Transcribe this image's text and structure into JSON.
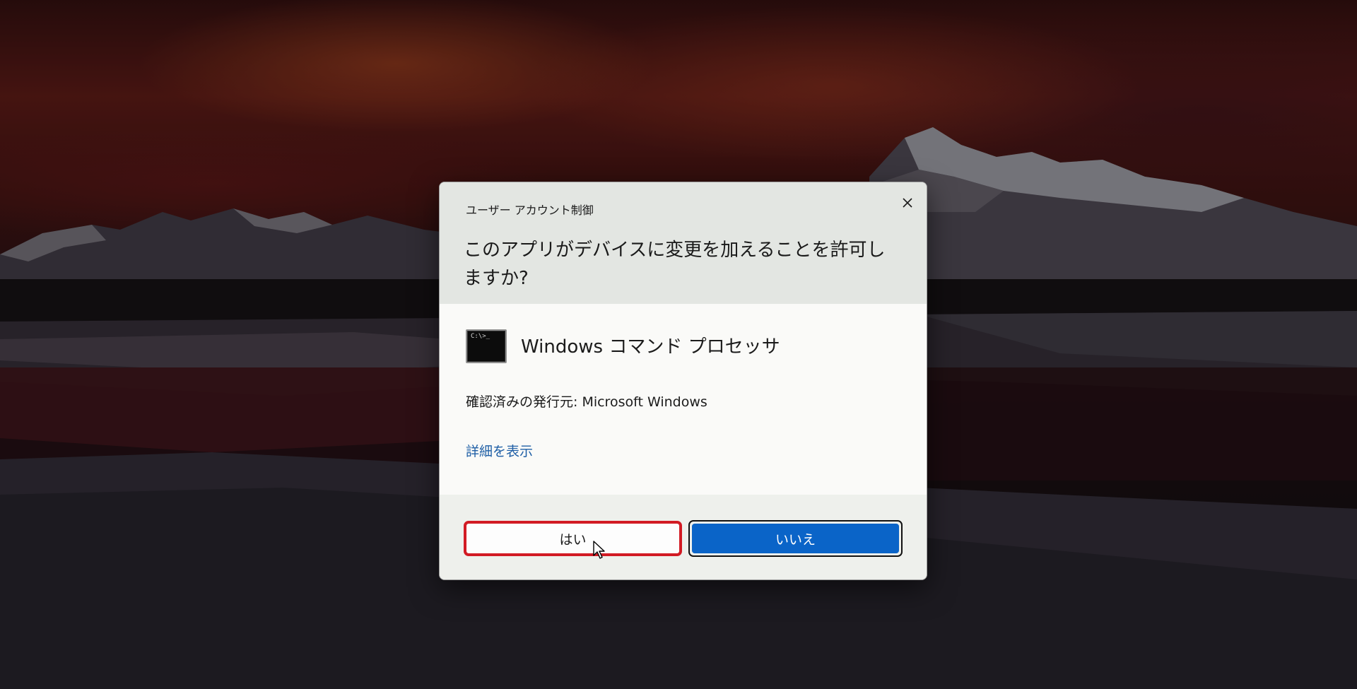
{
  "dialog": {
    "caption": "ユーザー アカウント制御",
    "question": "このアプリがデバイスに変更を加えることを許可しますか?",
    "app_name": "Windows コマンド プロセッサ",
    "app_icon_prompt": "C:\\>_",
    "publisher": "確認済みの発行元: Microsoft Windows",
    "details_link": "詳細を表示",
    "yes_label": "はい",
    "no_label": "いいえ",
    "icons": {
      "close": "close-icon",
      "app": "command-prompt-icon",
      "cursor": "mouse-pointer-icon"
    }
  },
  "colors": {
    "primary_button": "#0a64c8",
    "link": "#1f5fa6",
    "highlight_outline": "#d21b24",
    "header_bg": "#e3e6e2"
  }
}
